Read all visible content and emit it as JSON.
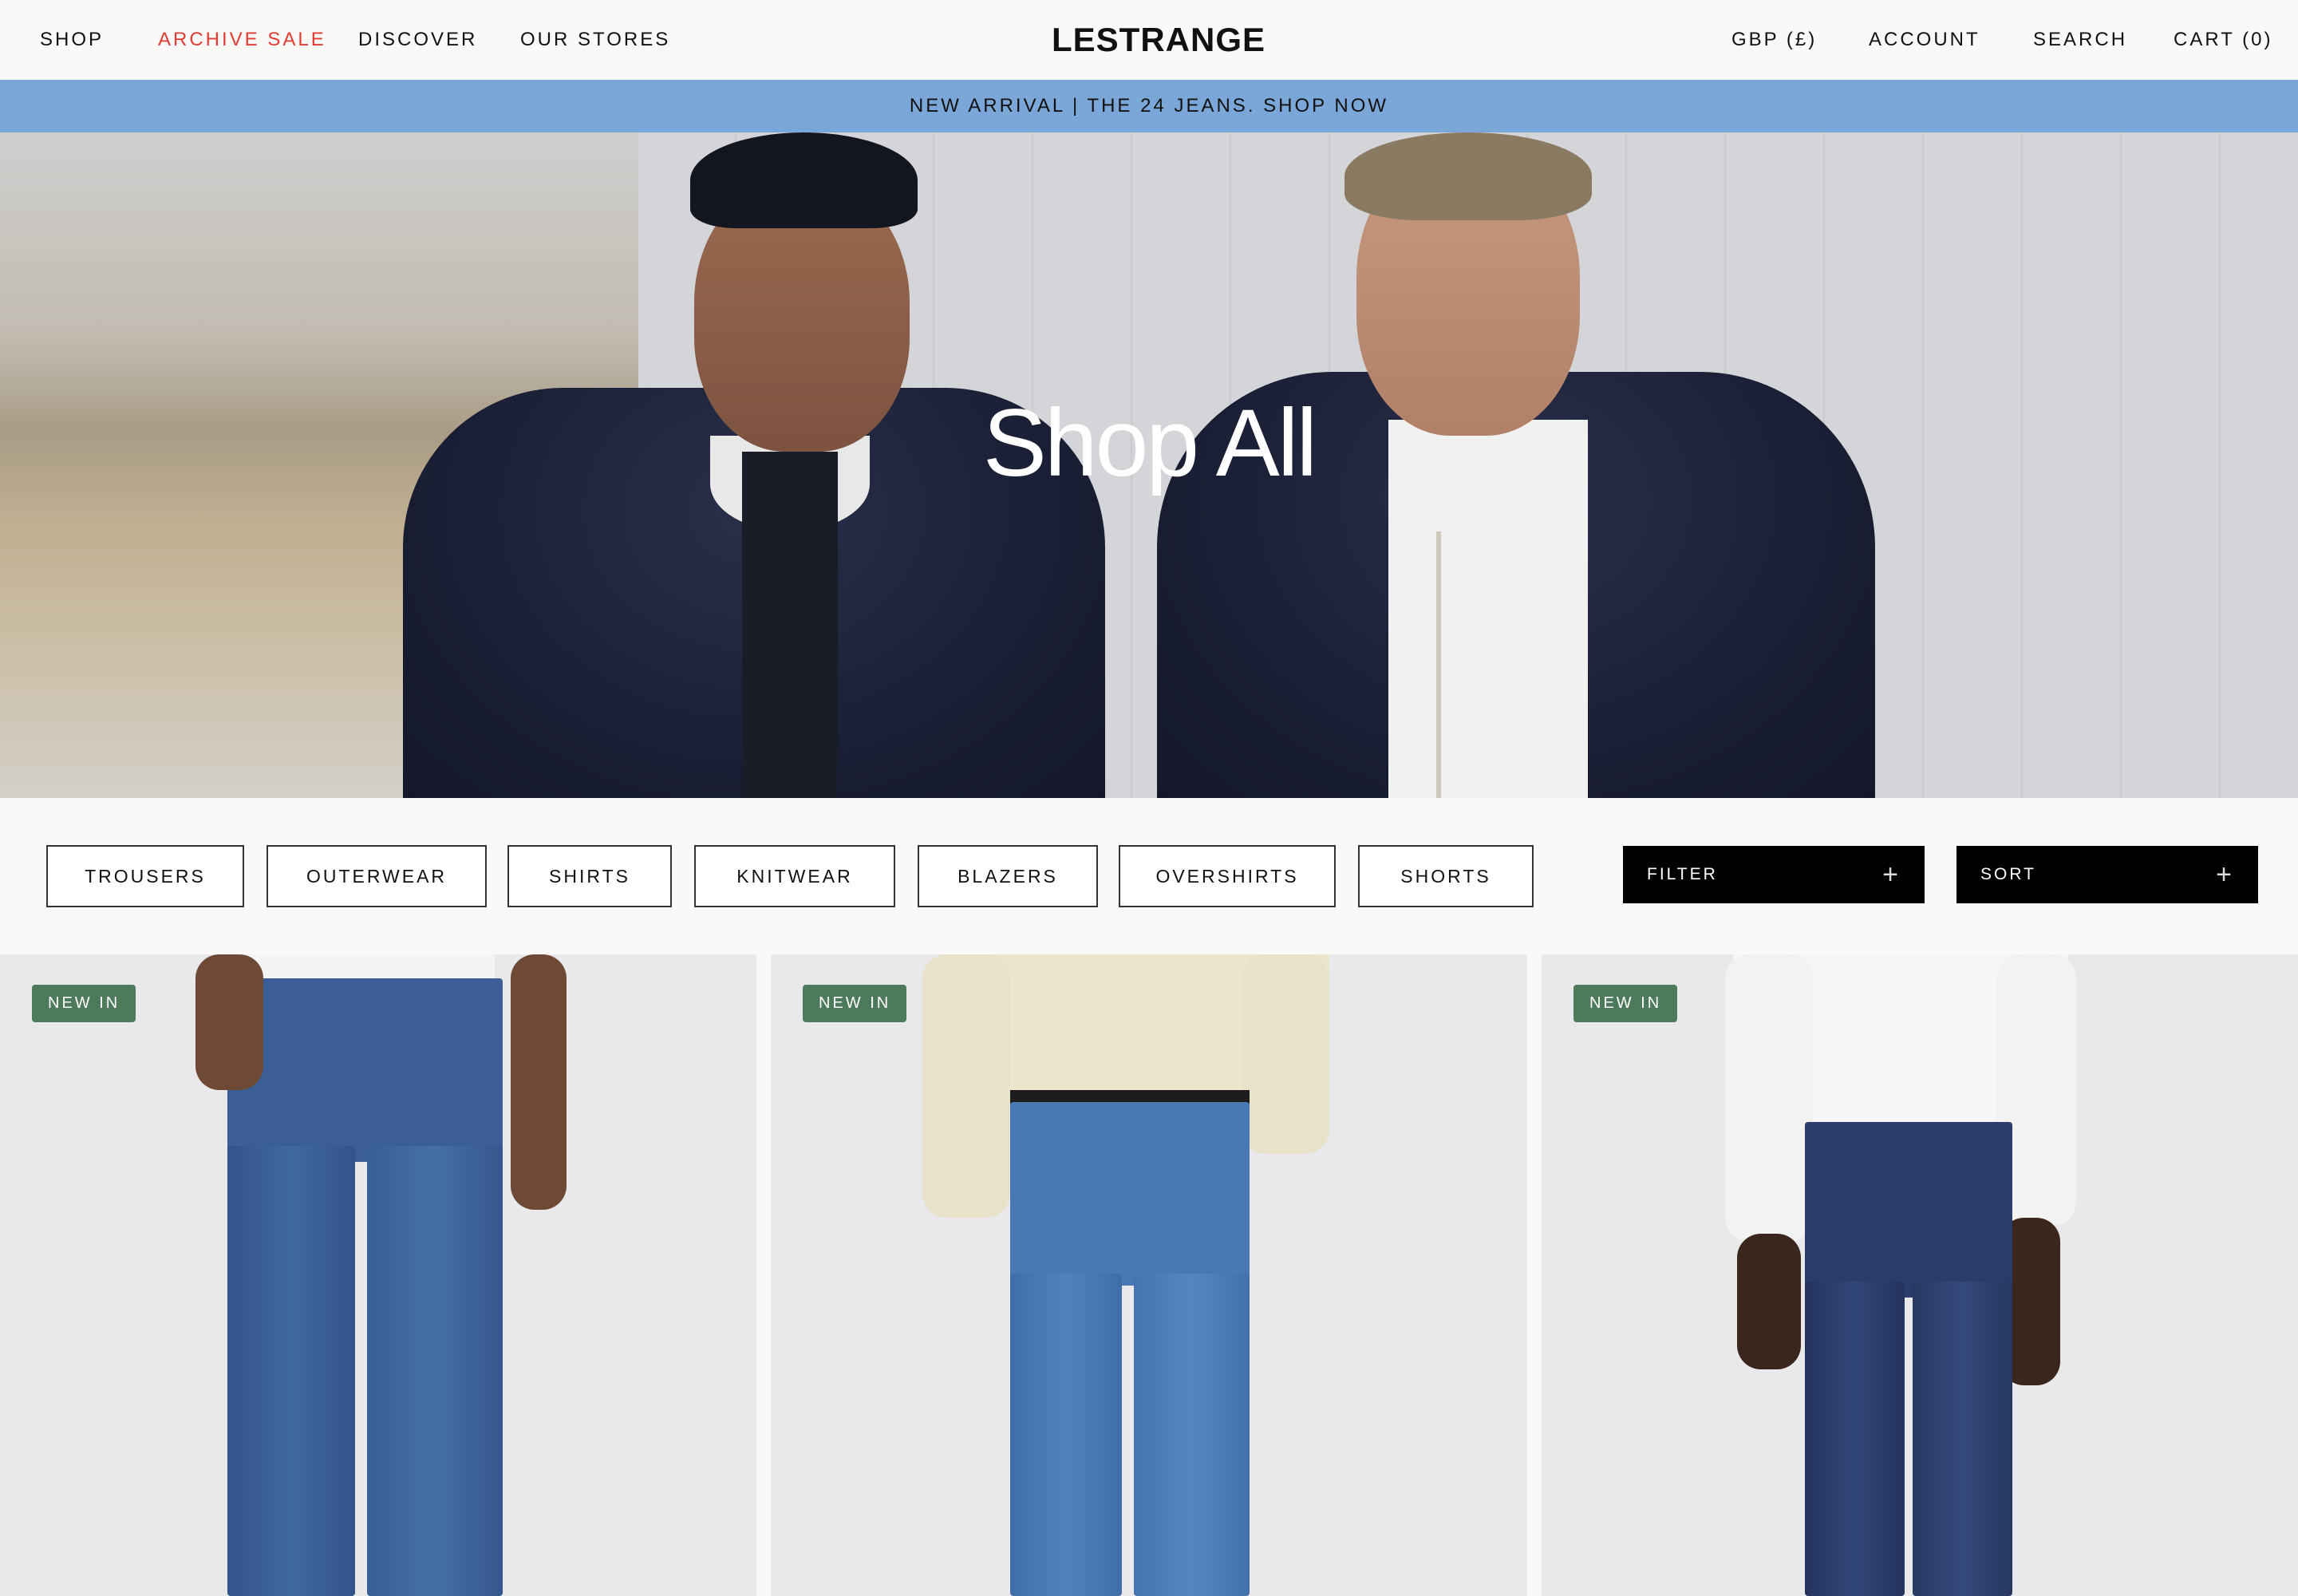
{
  "header": {
    "nav_left": [
      "SHOP",
      "ARCHIVE SALE",
      "DISCOVER",
      "OUR STORES"
    ],
    "logo": "LESTRANGE",
    "nav_right": [
      "GBP (£)",
      "ACCOUNT",
      "SEARCH",
      "CART (0)"
    ]
  },
  "banner": {
    "text": "NEW ARRIVAL | THE 24 JEANS. SHOP NOW"
  },
  "hero": {
    "title": "Shop All"
  },
  "categories": [
    "TROUSERS",
    "OUTERWEAR",
    "SHIRTS",
    "KNITWEAR",
    "BLAZERS",
    "OVERSHIRTS",
    "SHORTS"
  ],
  "controls": {
    "filter_label": "FILTER",
    "sort_label": "SORT",
    "icon": "plus-icon"
  },
  "products": [
    {
      "badge": "NEW IN",
      "denim_color": "#3b5f95"
    },
    {
      "badge": "NEW IN",
      "denim_color": "#4a78b4"
    },
    {
      "badge": "NEW IN",
      "denim_color": "#2b3c6b"
    }
  ],
  "colors": {
    "sale_red": "#e03c31",
    "banner_blue": "#7aa7d8",
    "badge_green": "#4e7a5c",
    "background": "#faf9f7"
  }
}
